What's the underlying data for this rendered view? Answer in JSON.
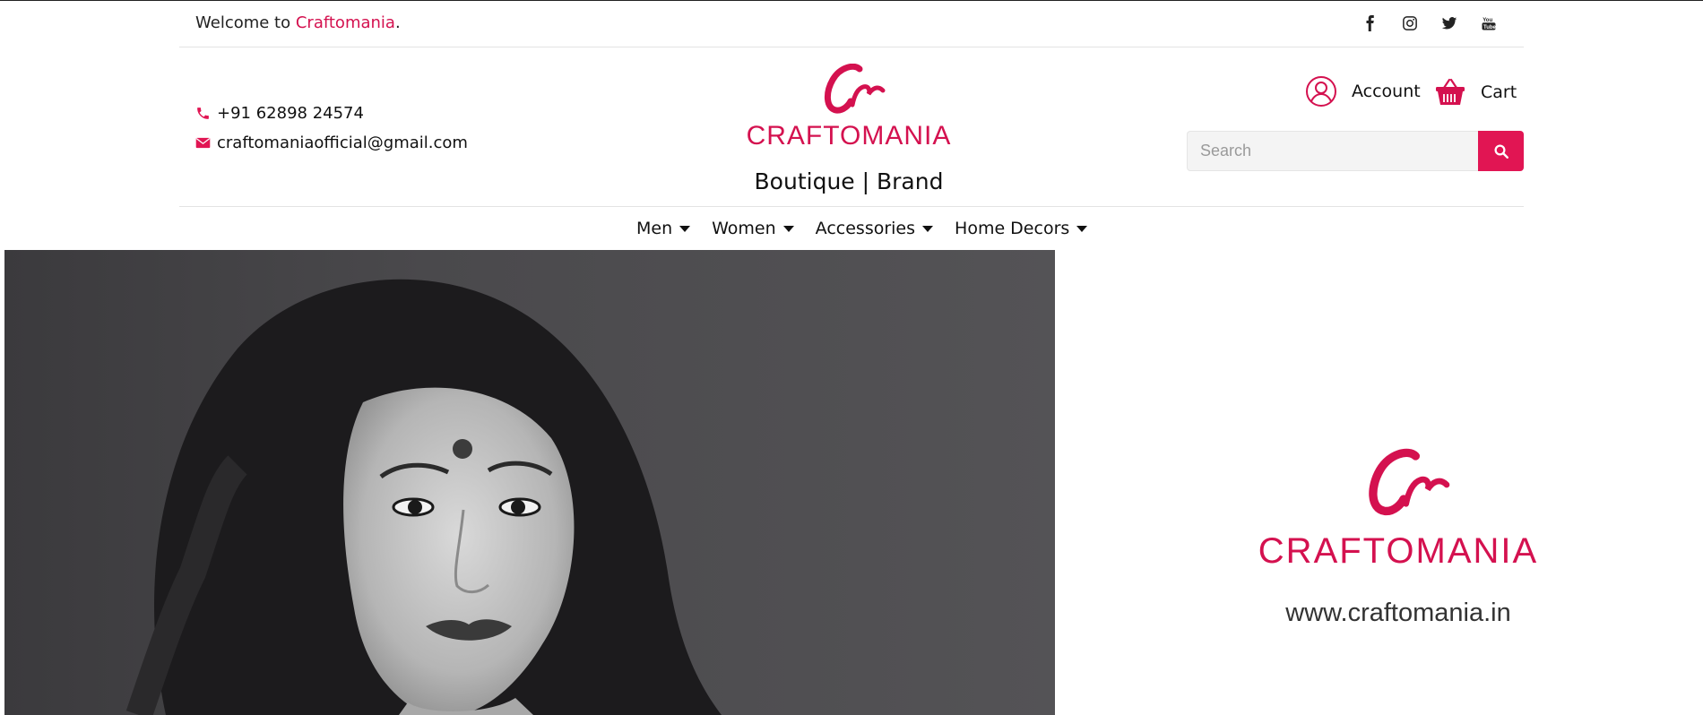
{
  "topbar": {
    "welcome_prefix": "Welcome to ",
    "brand": "Craftomania",
    "welcome_suffix": ".",
    "social_icons": [
      "facebook-icon",
      "instagram-icon",
      "twitter-icon",
      "youtube-icon"
    ]
  },
  "contact": {
    "phone": "+91 62898 24574",
    "email": "craftomaniaofficial@gmail.com"
  },
  "logo": {
    "wordmark": "CRAFTOMANIA",
    "tagline": "Boutique | Brand"
  },
  "user_menu": {
    "account_label": "Account",
    "cart_label": "Cart"
  },
  "search": {
    "placeholder": "Search",
    "value": ""
  },
  "nav": {
    "items": [
      {
        "label": "Men"
      },
      {
        "label": "Women"
      },
      {
        "label": "Accessories"
      },
      {
        "label": "Home Decors"
      }
    ]
  },
  "hero": {
    "brand_wordmark": "CRAFTOMANIA",
    "website": "www.craftomania.in"
  },
  "colors": {
    "accent": "#d4114f",
    "button": "#e11553",
    "text": "#111111"
  }
}
